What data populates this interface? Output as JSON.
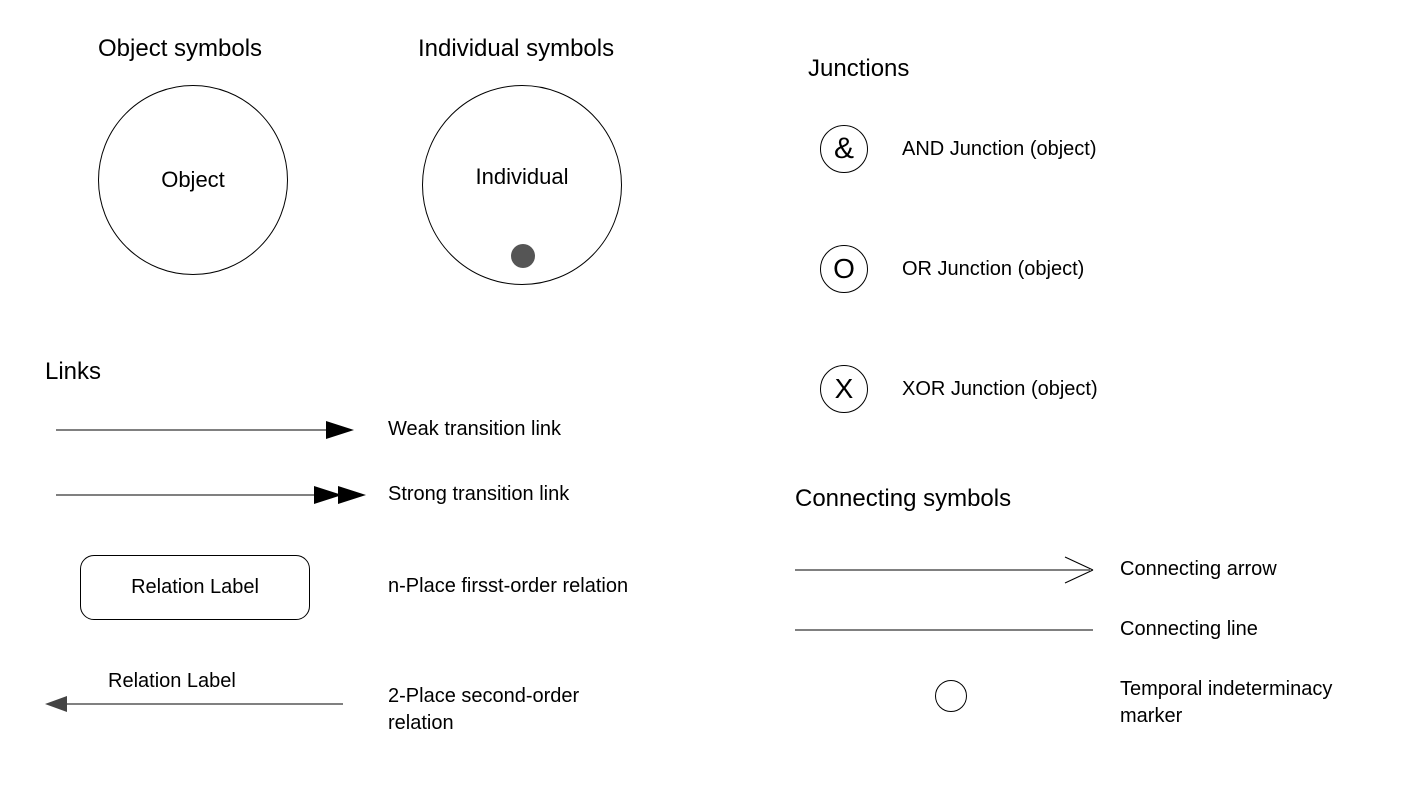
{
  "headers": {
    "objectSymbols": "Object symbols",
    "individualSymbols": "Individual symbols",
    "junctions": "Junctions",
    "links": "Links",
    "connectingSymbols": "Connecting symbols"
  },
  "objectCircle": {
    "label": "Object"
  },
  "individualCircle": {
    "label": "Individual"
  },
  "junctions": {
    "and": {
      "glyph": "&",
      "label": "AND Junction (object)"
    },
    "or": {
      "glyph": "O",
      "label": "OR Junction (object)"
    },
    "xor": {
      "glyph": "X",
      "label": "XOR Junction (object)"
    }
  },
  "links": {
    "weak": {
      "label": "Weak transition link"
    },
    "strong": {
      "label": "Strong transition link"
    },
    "nplace": {
      "boxLabel": "Relation Label",
      "label": "n-Place firsst-order relation"
    },
    "place2": {
      "lineLabel": "Relation Label",
      "label1": "2-Place second-order",
      "label2": "relation"
    }
  },
  "connecting": {
    "arrow": {
      "label": "Connecting arrow"
    },
    "line": {
      "label": "Connecting line"
    },
    "marker": {
      "label1": "Temporal indeterminacy",
      "label2": "marker"
    }
  }
}
